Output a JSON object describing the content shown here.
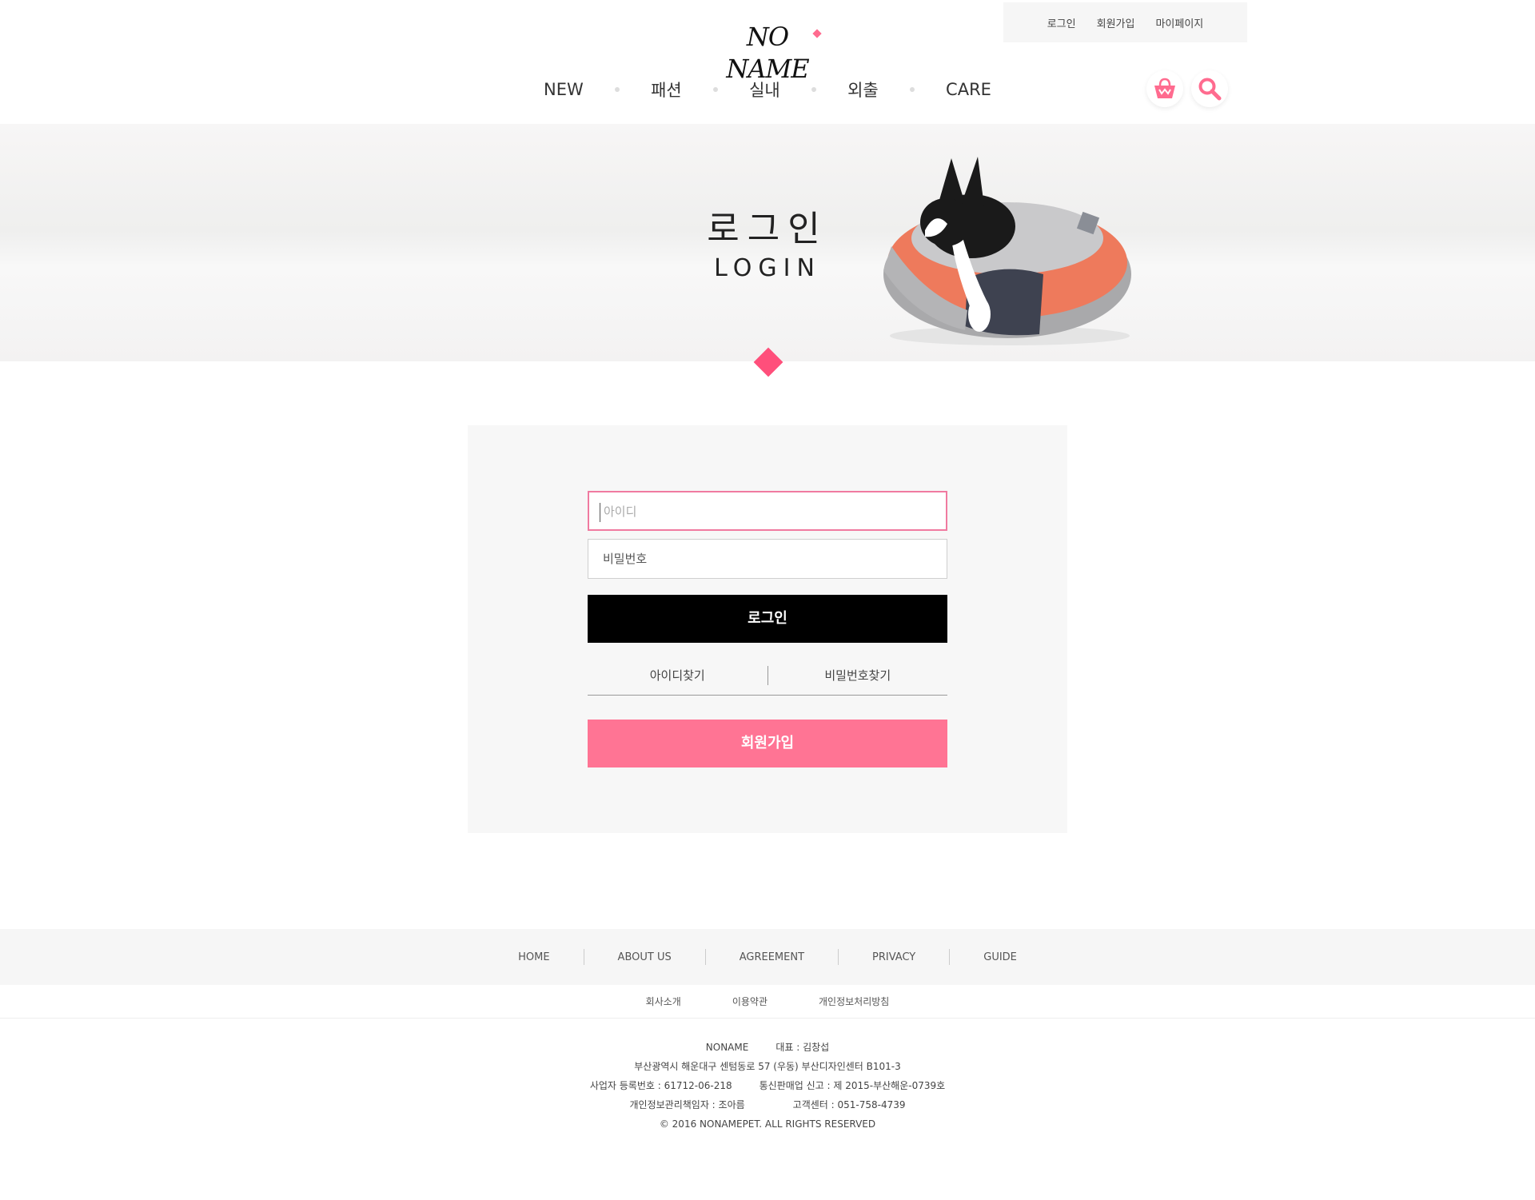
{
  "top_links": {
    "login": "로그인",
    "join": "회원가입",
    "mypage": "마이페이지"
  },
  "logo": "NO NAME",
  "nav": [
    "NEW",
    "패션",
    "실내",
    "외출",
    "CARE"
  ],
  "hero": {
    "title": "로그인",
    "subtitle": "LOGIN"
  },
  "form": {
    "id_placeholder": "아이디",
    "password_placeholder": "비밀번호",
    "login_button": "로그인",
    "find_id": "아이디찾기",
    "find_password": "비밀번호찾기",
    "join_button": "회원가입"
  },
  "footer": {
    "nav": [
      "HOME",
      "ABOUT US",
      "AGREEMENT",
      "PRIVACY",
      "GUIDE"
    ],
    "sub": [
      "회사소개",
      "이용약관",
      "개인정보처리방침"
    ],
    "company": "NONAME",
    "ceo": "대표 : 김창섭",
    "address": "부산광역시 해운대구 센텀동로 57 (우동) 부산디자인센터 B101-3",
    "biz_no": "사업자 등록번호 : 61712-06-218",
    "mail_order": "통신판매업 신고 : 제 2015-부산해운-0739호",
    "privacy_officer": "개인정보관리책임자 : 조아름",
    "customer_center": "고객센터 : 051-758-4739",
    "copyright": "© 2016 NONAMEPET. ALL RIGHTS RESERVED"
  },
  "colors": {
    "accent_pink": "#ff7494",
    "diamond": "#ff4f7b",
    "black": "#000000"
  }
}
